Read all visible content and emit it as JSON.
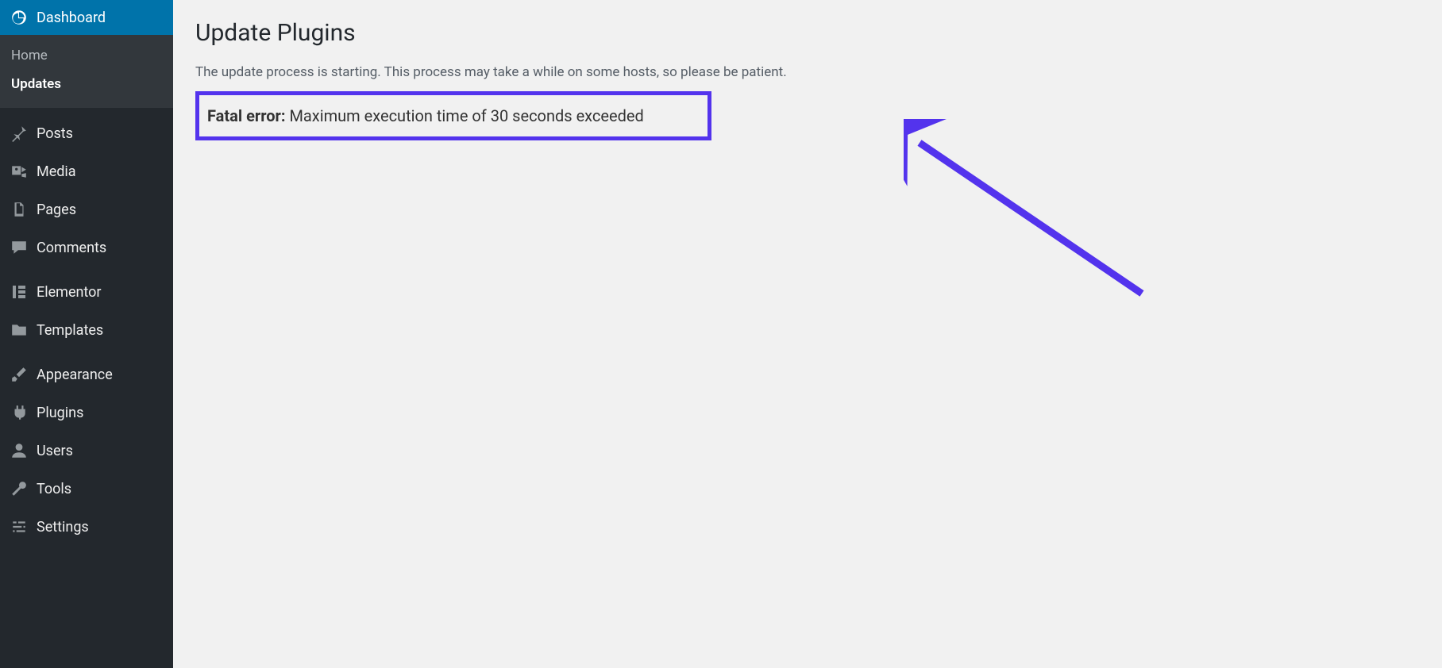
{
  "sidebar": {
    "current": "Dashboard",
    "submenu": {
      "home": "Home",
      "updates": "Updates"
    },
    "items": [
      {
        "label": "Posts",
        "icon": "pin-icon"
      },
      {
        "label": "Media",
        "icon": "media-icon"
      },
      {
        "label": "Pages",
        "icon": "pages-icon"
      },
      {
        "label": "Comments",
        "icon": "comments-icon"
      }
    ],
    "items2": [
      {
        "label": "Elementor",
        "icon": "elementor-icon"
      },
      {
        "label": "Templates",
        "icon": "folder-icon"
      }
    ],
    "items3": [
      {
        "label": "Appearance",
        "icon": "brush-icon"
      },
      {
        "label": "Plugins",
        "icon": "plug-icon"
      },
      {
        "label": "Users",
        "icon": "user-icon"
      },
      {
        "label": "Tools",
        "icon": "wrench-icon"
      },
      {
        "label": "Settings",
        "icon": "sliders-icon"
      }
    ]
  },
  "page": {
    "title": "Update Plugins",
    "subtext": "The update process is starting. This process may take a while on some hosts, so please be patient.",
    "error_label": "Fatal error:",
    "error_message": " Maximum execution time of 30 seconds exceeded"
  },
  "colors": {
    "annotation": "#5333ed",
    "accent": "#0073aa"
  }
}
